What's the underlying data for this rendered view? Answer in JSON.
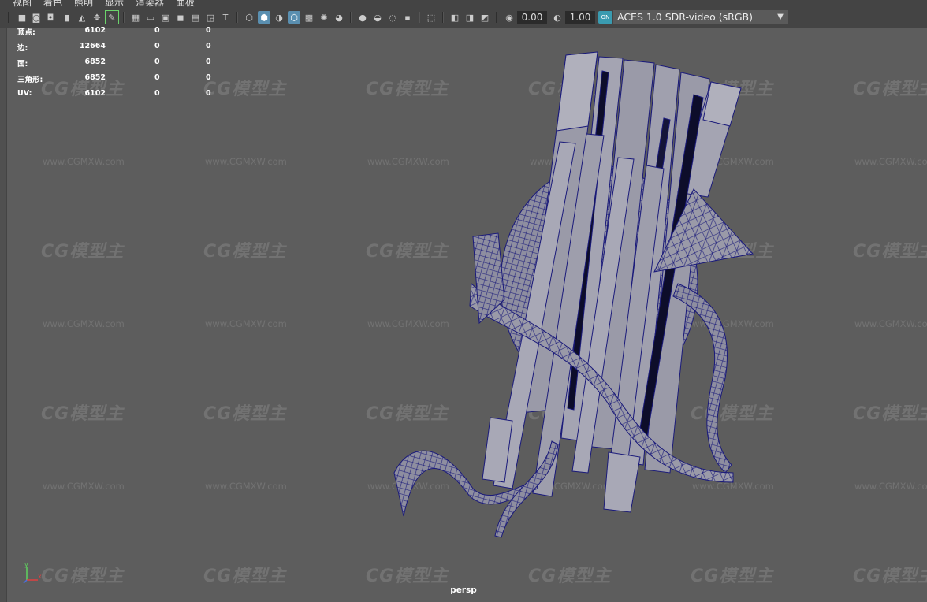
{
  "menu": [
    "视图",
    "着色",
    "照明",
    "显示",
    "渲染器",
    "面板"
  ],
  "toolbar": {
    "exposure_value": "0.00",
    "gamma_value": "1.00",
    "color_badge": "ON",
    "color_space": "ACES 1.0 SDR-video (sRGB)",
    "dropdown_arrow": "▼"
  },
  "hud": {
    "rows": [
      {
        "label": "顶点:",
        "v1": "6102",
        "v2": "0",
        "v3": "0"
      },
      {
        "label": "边:",
        "v1": "12664",
        "v2": "0",
        "v3": "0"
      },
      {
        "label": "面:",
        "v1": "6852",
        "v2": "0",
        "v3": "0"
      },
      {
        "label": "三角形:",
        "v1": "6852",
        "v2": "0",
        "v3": "0"
      },
      {
        "label": "UV:",
        "v1": "6102",
        "v2": "0",
        "v3": "0"
      }
    ]
  },
  "watermark": {
    "logo": "CG模型主",
    "url": "www.CGMXW.com"
  },
  "viewport": {
    "camera_label": "persp",
    "axis_y": "y",
    "axis_x": "x"
  },
  "colors": {
    "background": "#5d5d5d",
    "toolbar": "#444444",
    "wireframe": "#1a1a7a",
    "mesh_fill": "#9a9aa8",
    "active_icon": "#5a8fb0"
  }
}
